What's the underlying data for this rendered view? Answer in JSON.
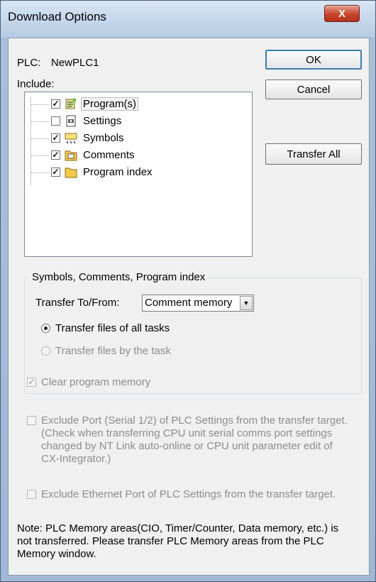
{
  "window": {
    "title": "Download Options",
    "close_glyph": "X"
  },
  "plc": {
    "label": "PLC:",
    "name": "NewPLC1"
  },
  "include_label": "Include:",
  "tree": [
    {
      "label": "Program(s)",
      "checked": true,
      "icon": "program-icon"
    },
    {
      "label": "Settings",
      "checked": false,
      "icon": "settings-icon"
    },
    {
      "label": "Symbols",
      "checked": true,
      "icon": "symbols-icon"
    },
    {
      "label": "Comments",
      "checked": true,
      "icon": "comments-folder-icon"
    },
    {
      "label": "Program index",
      "checked": true,
      "icon": "folder-icon"
    }
  ],
  "buttons": {
    "ok": "OK",
    "cancel": "Cancel",
    "transfer_all": "Transfer All"
  },
  "group": {
    "legend": "Symbols, Comments, Program index",
    "transfer_label": "Transfer To/From:",
    "transfer_value": "Comment memory",
    "radio_all": "Transfer files of all tasks",
    "radio_task": "Transfer files by the task"
  },
  "options": {
    "clear_memory": "Clear program memory",
    "exclude_port_1": "Exclude Port (Serial 1/2) of PLC Settings from the transfer target.",
    "exclude_port_2": "(Check when transferring CPU unit serial comms port settings",
    "exclude_port_3": "changed by NT Link auto-online or CPU unit parameter edit of",
    "exclude_port_4": "CX-Integrator.)",
    "exclude_ethernet": "Exclude Ethernet Port of PLC Settings from the transfer target."
  },
  "note": {
    "line1": "Note: PLC Memory areas(CIO, Timer/Counter, Data memory, etc.) is",
    "line2": "not transferred. Please transfer PLC Memory areas from the PLC",
    "line3": "Memory window."
  },
  "check_glyph": "✓"
}
